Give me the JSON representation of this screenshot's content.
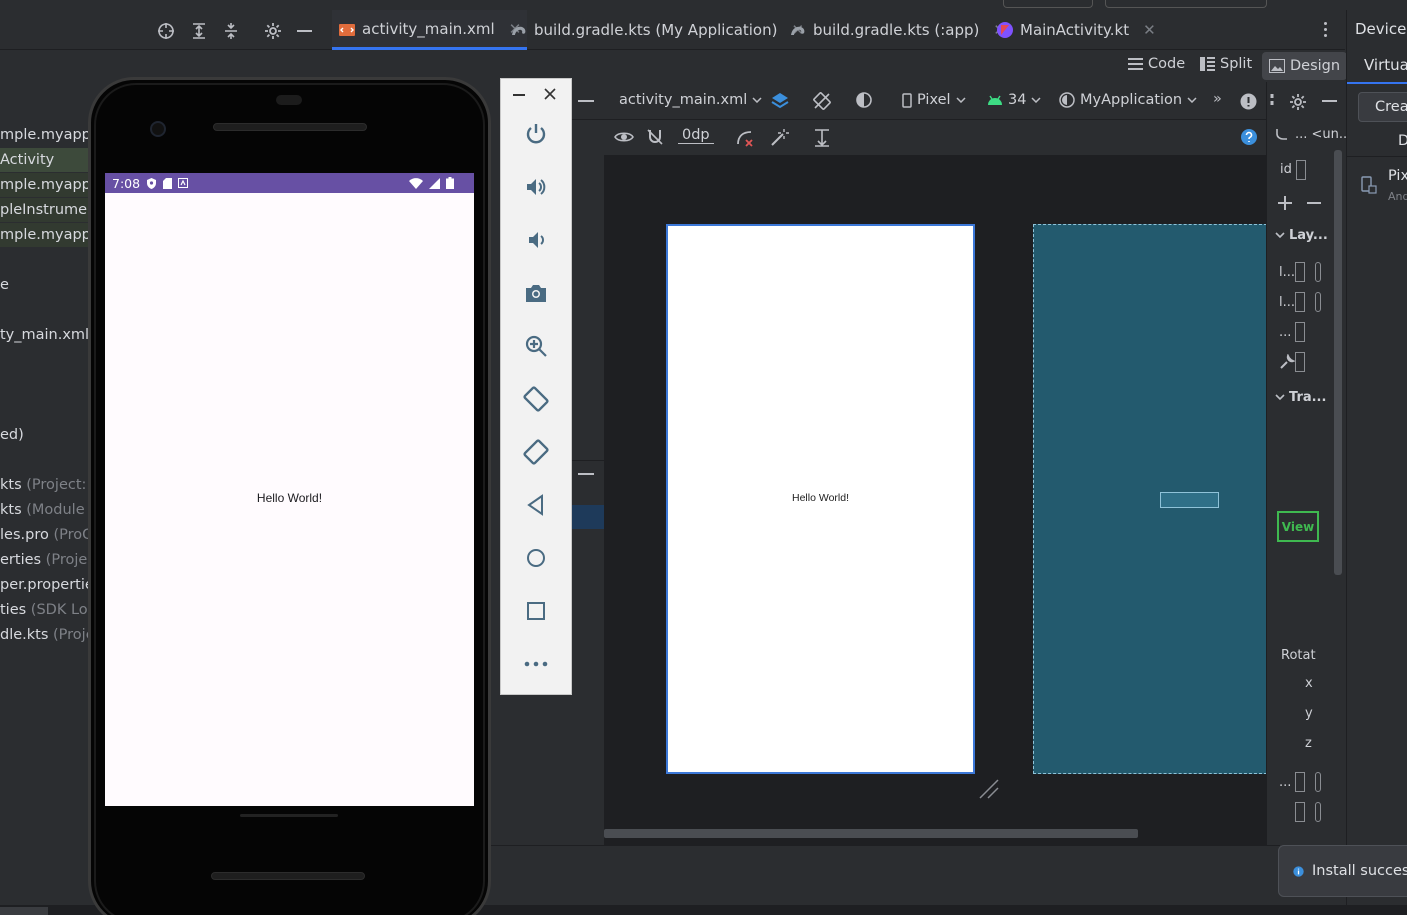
{
  "editor_tabs": [
    {
      "label": "activity_main.xml",
      "icon": "xml-layout-icon",
      "active": true
    },
    {
      "label": "build.gradle.kts (My Application)",
      "icon": "gradle-icon"
    },
    {
      "label": "build.gradle.kts (:app)",
      "icon": "gradle-icon"
    },
    {
      "label": "MainActivity.kt",
      "icon": "kotlin-icon"
    }
  ],
  "view_modes": {
    "code": "Code",
    "split": "Split",
    "design": "Design"
  },
  "right_panel": {
    "title": "Device M",
    "tab": "Virtual",
    "create_button": "Creat",
    "column_header": "D",
    "device_name": "Pix",
    "device_sub": "And"
  },
  "project_tree": [
    {
      "text": "mple.myappli",
      "dim": ""
    },
    {
      "text": "Activity",
      "dim": "",
      "selected": true
    },
    {
      "text": "mple.myappli",
      "dim": "",
      "highlight": true
    },
    {
      "text": "pleInstrument",
      "dim": "",
      "highlight": true
    },
    {
      "text": "mple.myappli",
      "dim": "",
      "highlight": true
    },
    {
      "text": "e",
      "dim": ""
    },
    {
      "text": "ty_main.xml",
      "dim": ""
    },
    {
      "text": "ed)",
      "dim": ""
    },
    {
      "text": "kts",
      "dim": " (Project: M"
    },
    {
      "text": "kts",
      "dim": " (Module :"
    },
    {
      "text": "les.pro",
      "dim": " (ProGu"
    },
    {
      "text": "erties",
      "dim": " (Project"
    },
    {
      "text": "per.propertie",
      "dim": ""
    },
    {
      "text": "ties",
      "dim": " (SDK Loc"
    },
    {
      "text": "dle.kts",
      "dim": " (Projec"
    }
  ],
  "design_toolbar": {
    "file": "activity_main.xml",
    "device": "Pixel",
    "api": "34",
    "theme": "MyApplication",
    "margin": "0dp"
  },
  "canvas": {
    "hello_text": "Hello World!"
  },
  "attributes": {
    "path": "... <un..",
    "id_label": "id",
    "layout_section": "Lay...",
    "transforms_section": "Tra...",
    "view_label": "View",
    "rotation_label": "Rotat",
    "axes": [
      "x",
      "y",
      "z"
    ],
    "rows": [
      "l...",
      "l...",
      "...",
      "..."
    ]
  },
  "phone": {
    "time": "7:08",
    "hello_text": "Hello World!"
  },
  "toast": {
    "text": "Install success"
  },
  "colors": {
    "accent": "#3574f0",
    "phone_status": "#6750a4",
    "blueprint": "#235a6e",
    "view_badge": "#3fb950"
  }
}
